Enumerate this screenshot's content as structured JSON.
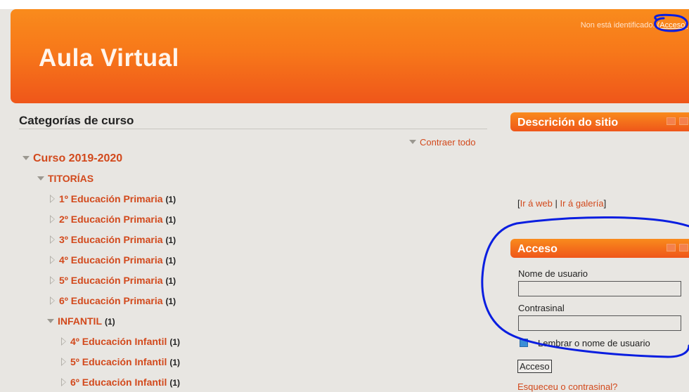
{
  "header": {
    "site_title": "Aula Virtual",
    "not_logged_text": "Non está identificado.",
    "login_link": "(Acceso)"
  },
  "categories": {
    "heading": "Categorías de curso",
    "collapse_all": "Contraer todo",
    "top": {
      "label": "Curso 2019-2020"
    },
    "tutorias": {
      "label": "TITORÍAS",
      "items": [
        {
          "label": "1º Educación Primaria",
          "count": "(1)"
        },
        {
          "label": "2º Educación Primaria",
          "count": "(1)"
        },
        {
          "label": "3º Educación Primaria",
          "count": "(1)"
        },
        {
          "label": "4º Educación Primaria",
          "count": "(1)"
        },
        {
          "label": "5º Educación Primaria",
          "count": "(1)"
        },
        {
          "label": "6º Educación Primaria",
          "count": "(1)"
        }
      ]
    },
    "infantil": {
      "label": "INFANTIL",
      "count": "(1)",
      "items": [
        {
          "label": "4º Educación Infantil",
          "count": "(1)"
        },
        {
          "label": "5º Educación Infantil",
          "count": "(1)"
        },
        {
          "label": "6º Educación Infantil",
          "count": "(1)"
        }
      ]
    }
  },
  "site_block": {
    "title": "Descrición do sitio",
    "link_open": "[",
    "link_web": "Ir á web",
    "separator": " | ",
    "link_gallery": "Ir á galería",
    "link_close": "]"
  },
  "login_block": {
    "title": "Acceso",
    "username_label": "Nome de usuario",
    "username_value": "",
    "password_label": "Contrasinal",
    "password_value": "",
    "remember_label": "Lembrar o nome de usuario",
    "remember_checked": true,
    "submit_label": "Acceso",
    "forgot_label": "Esqueceu o contrasinal?"
  },
  "colors": {
    "accent": "#d2491c",
    "header_top": "#f98b1c",
    "header_bottom": "#ef561a",
    "annotation": "#0a1ee0"
  },
  "annotations": {
    "marker_color": "#0a1ee0",
    "description": "hand-drawn blue circles around login link and login block"
  }
}
